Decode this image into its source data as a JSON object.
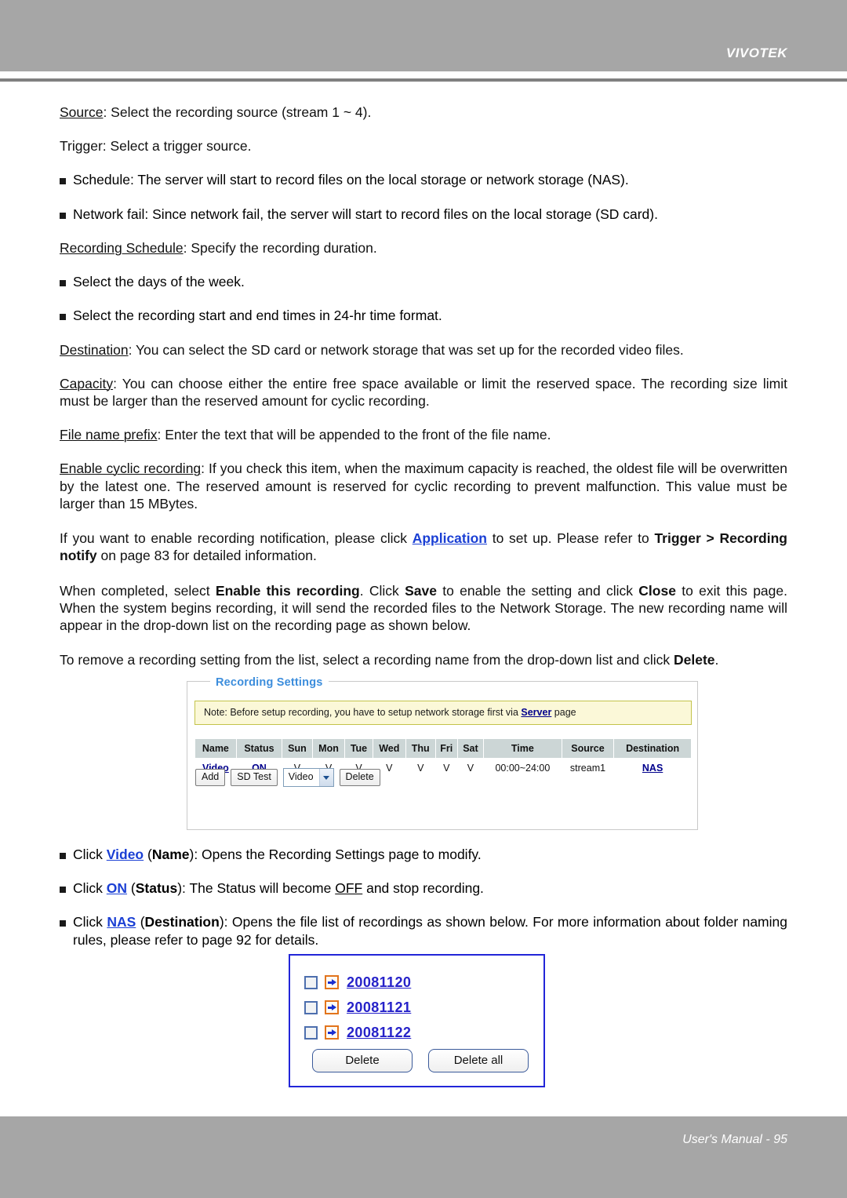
{
  "header": {
    "brand": "VIVOTEK"
  },
  "body": {
    "p_source_label": "Source",
    "p_source_rest": ": Select the recording source (stream 1 ~ 4).",
    "p_trigger": "Trigger: Select a trigger source.",
    "b_schedule": "Schedule: The server will start to record files on the local storage or network storage (NAS).",
    "b_networkfail": "Network fail: Since network fail, the server will start to record files on the local storage (SD card).",
    "p_recsched_label": "Recording Schedule",
    "p_recsched_rest": ": Specify the recording duration.",
    "b_days": "Select the days of the week.",
    "b_times": "Select the recording start and end times in 24-hr time format.",
    "p_dest_label": "Destination",
    "p_dest_rest": ": You can select the SD card or network storage that was set up for the recorded video files.",
    "p_cap_label": "Capacity",
    "p_cap_rest": ": You can choose either the entire free space available or limit the reserved space. The recording size limit must be larger than the reserved amount for cyclic recording.",
    "p_prefix_label": "File name prefix",
    "p_prefix_rest": ": Enter the text that will be appended to the front of the file name.",
    "p_cyclic_label": "Enable cyclic recording",
    "p_cyclic_rest": ": If you check this item, when the maximum capacity is reached, the oldest file will be overwritten by the latest one. The reserved amount is reserved for cyclic recording to prevent malfunction. This value must be larger than 15 MBytes.",
    "p_notify_a": "If you want to enable recording notification, please click ",
    "p_notify_link": "Application",
    "p_notify_b": " to set up. Please refer to ",
    "p_notify_bold1": "Trigger > Recording notify",
    "p_notify_c": " on page 83 for detailed information.",
    "p_complete_a": "When completed, select ",
    "p_complete_b1": "Enable this recording",
    "p_complete_b": ". Click ",
    "p_complete_b2": "Save",
    "p_complete_c": " to enable the setting and click ",
    "p_complete_b3": "Close",
    "p_complete_d": " to exit this page. When the system begins recording, it will send the recorded files to the Network Storage. The new recording name will appear in the drop-down list on the recording page as shown below.",
    "p_remove_a": "To remove a recording setting from the list, select a recording name from the drop-down list and click ",
    "p_remove_b": "Delete",
    "p_remove_c": "."
  },
  "rec_panel": {
    "legend": "Recording Settings",
    "note_a": "Note: Before setup recording, you have to setup network storage first via ",
    "note_link": "Server",
    "note_b": " page",
    "columns": [
      "Name",
      "Status",
      "Sun",
      "Mon",
      "Tue",
      "Wed",
      "Thu",
      "Fri",
      "Sat",
      "Time",
      "Source",
      "Destination"
    ],
    "row": {
      "name": "Video",
      "status": "ON",
      "sun": "V",
      "mon": "V",
      "tue": "V",
      "wed": "V",
      "thu": "V",
      "fri": "V",
      "sat": "V",
      "time": "00:00~24:00",
      "source": "stream1",
      "destination": "NAS"
    },
    "buttons": {
      "add": "Add",
      "sd_test": "SD Test",
      "delete": "Delete"
    },
    "select_value": "Video"
  },
  "bottom_bullets": {
    "b1_a": "Click ",
    "b1_link": "Video",
    "b1_b": " (",
    "b1_bold": "Name",
    "b1_c": "): Opens the Recording Settings page to modify.",
    "b2_a": "Click ",
    "b2_link": "ON",
    "b2_b": " (",
    "b2_bold": "Status",
    "b2_c": "): The Status will become ",
    "b2_link2": "OFF",
    "b2_d": " and stop recording.",
    "b3_a": "Click ",
    "b3_link": "NAS",
    "b3_b": " (",
    "b3_bold": "Destination",
    "b3_c": "): Opens the file list of recordings as shown below. For more information about folder naming rules, please refer to page 92 for details."
  },
  "file_box": {
    "items": [
      "20081120",
      "20081121",
      "20081122"
    ],
    "delete_label": "Delete",
    "delete_all_label": "Delete all"
  },
  "footer": {
    "text": "User's Manual - 95"
  },
  "colors": {
    "band_gray": "#a6a6a6",
    "rule_gray": "#808080",
    "link_blue": "#1a3fd4",
    "panel_legend_blue": "#3c8ddc",
    "note_bg": "#fbf8d8",
    "note_border": "#c3c34a",
    "table_header_bg": "#ccd6d6",
    "file_box_border": "#2226d8",
    "file_link_blue": "#2622c9",
    "arrow_icon_orange": "#e2741c"
  }
}
